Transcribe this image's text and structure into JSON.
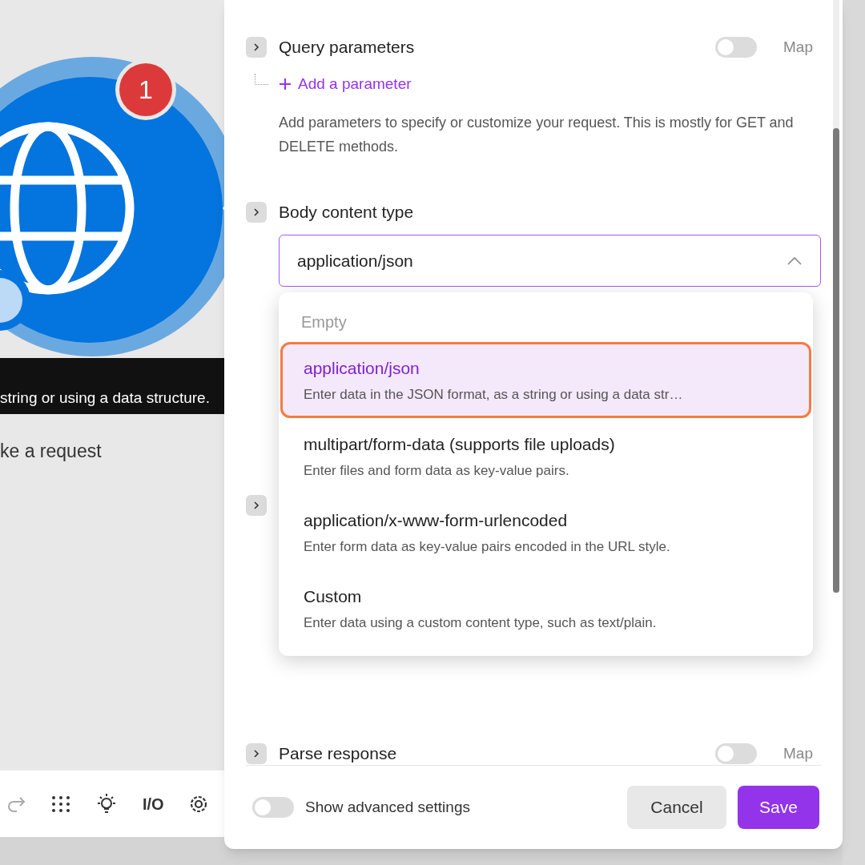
{
  "canvas": {
    "badge": "1",
    "tooltip": "string or using a data structure.",
    "module_subtitle": "ke a request",
    "toolbar_label": "I/O"
  },
  "panel": {
    "query_parameters": {
      "label": "Query parameters",
      "expanded": false,
      "map_on": false,
      "map_label": "Map",
      "add_link": "Add a parameter",
      "help": "Add parameters to specify or customize your request. This is mostly for GET and DELETE methods."
    },
    "body_content_type": {
      "label": "Body content type",
      "expanded": false,
      "value": "application/json",
      "open": true,
      "options": [
        {
          "kind": "empty",
          "label": "Empty",
          "selected": false
        },
        {
          "kind": "option",
          "label": "application/json",
          "description": "Enter data in the JSON format, as a string or using a data str…",
          "selected": true
        },
        {
          "kind": "option",
          "label": "multipart/form-data (supports file uploads)",
          "description": "Enter files and form data as key-value pairs.",
          "selected": false
        },
        {
          "kind": "option",
          "label": "application/x-www-form-urlencoded",
          "description": "Enter form data as key-value pairs encoded in the URL style.",
          "selected": false
        },
        {
          "kind": "option",
          "label": "Custom",
          "description": "Enter data using a custom content type, such as text/plain.",
          "selected": false
        }
      ]
    },
    "hidden_section": {
      "expanded": false
    },
    "parse_response": {
      "label": "Parse response",
      "expanded": false,
      "map_on": false,
      "map_label": "Map"
    },
    "footer": {
      "advanced_label": "Show advanced settings",
      "advanced_on": false,
      "buttons": [
        {
          "kind": "secondary",
          "label": "Cancel"
        },
        {
          "kind": "primary",
          "label": "Save"
        }
      ]
    }
  }
}
